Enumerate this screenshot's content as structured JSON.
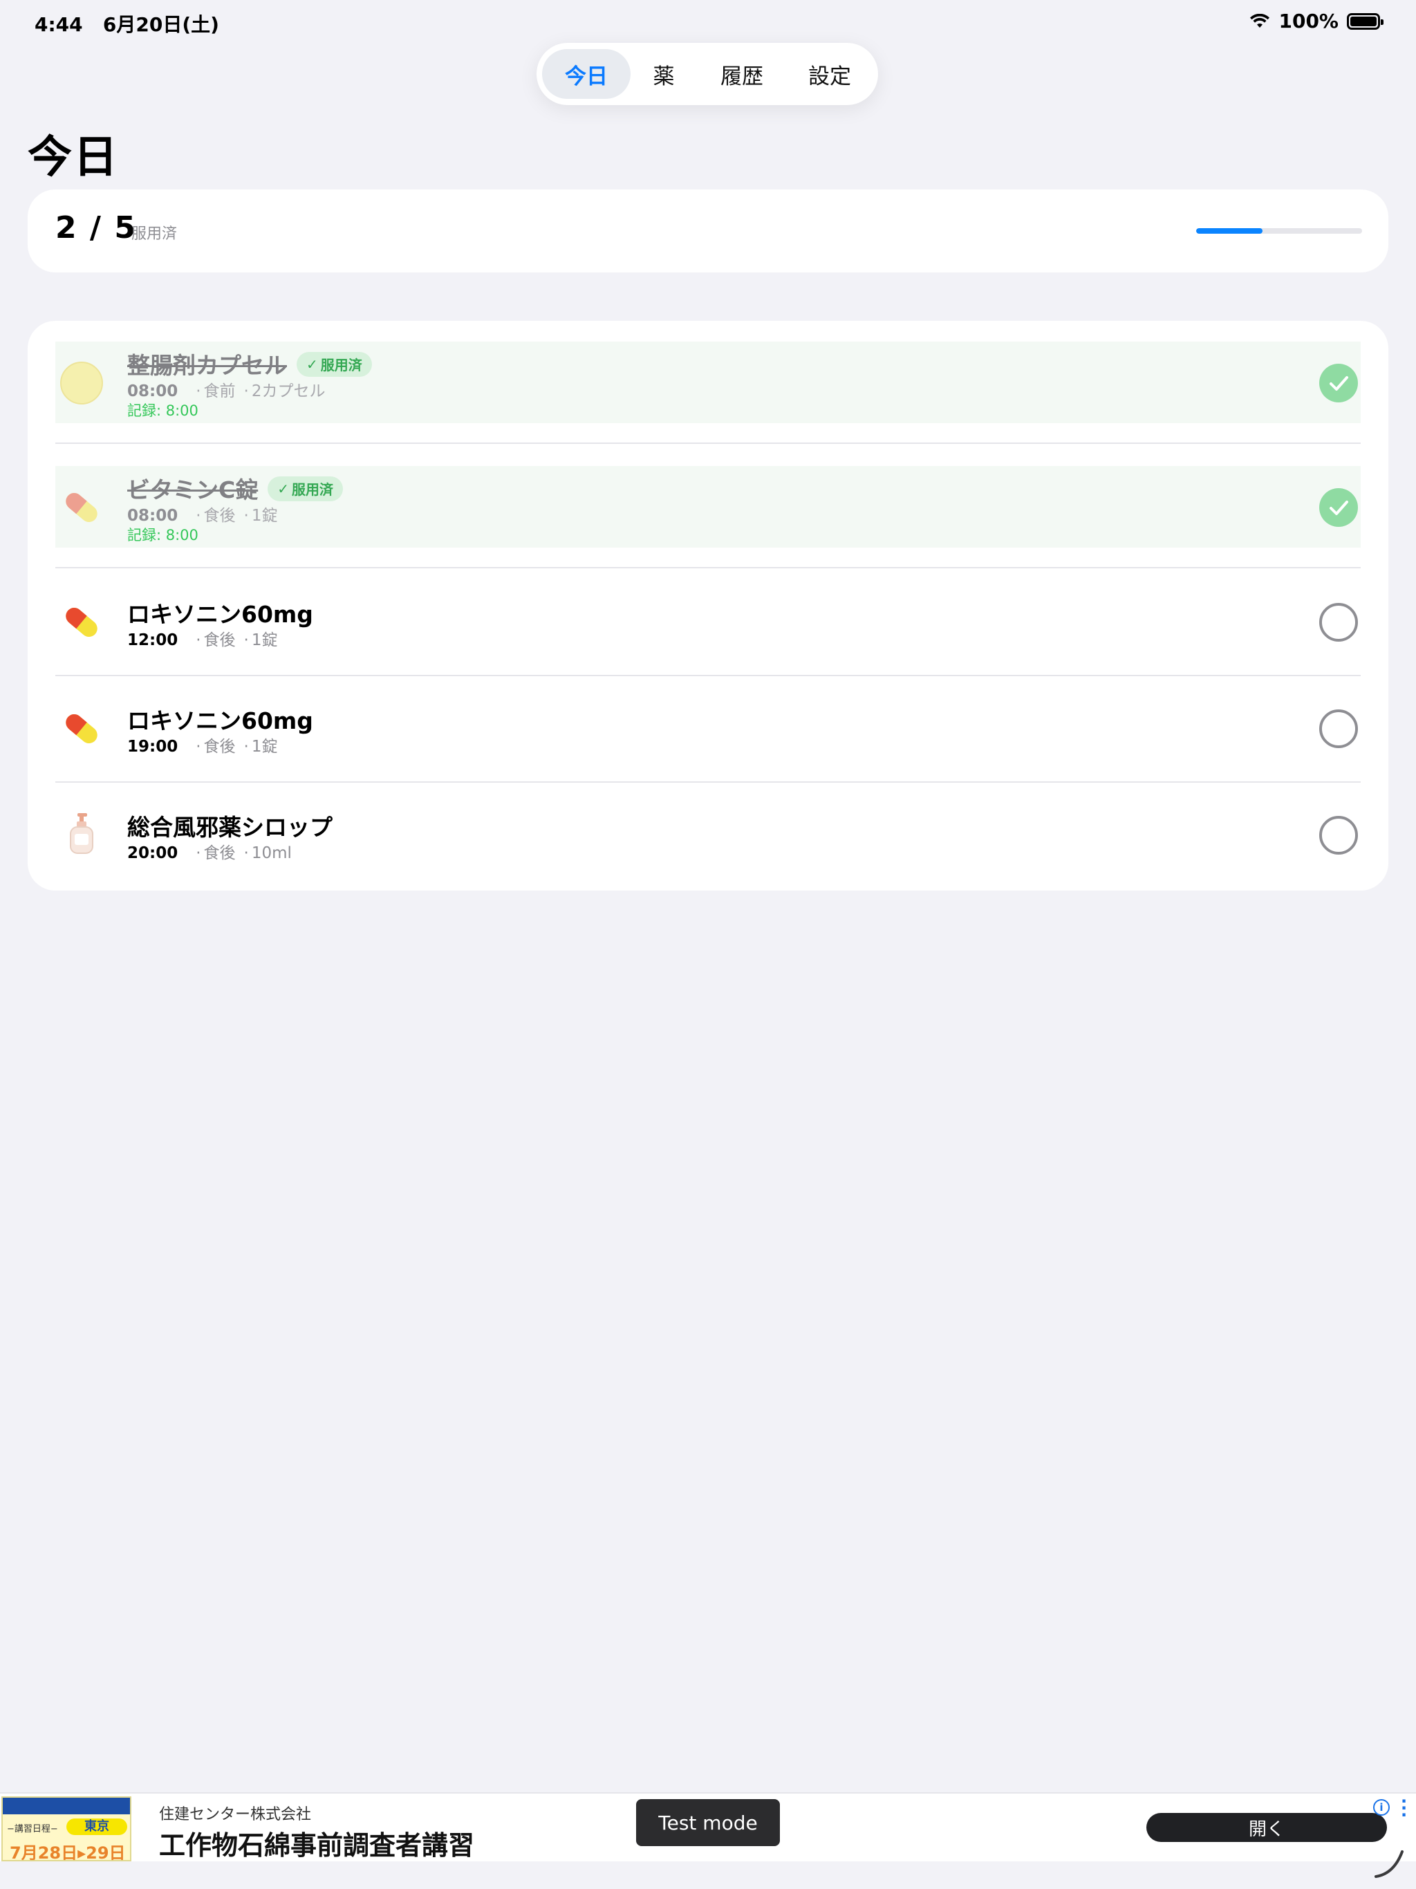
{
  "status": {
    "time": "4:44",
    "date": "6月20日(土)",
    "battery": "100%"
  },
  "tabs": [
    {
      "label": "今日",
      "active": true
    },
    {
      "label": "薬",
      "active": false
    },
    {
      "label": "履歴",
      "active": false
    },
    {
      "label": "設定",
      "active": false
    }
  ],
  "page": {
    "title": "今日"
  },
  "summary": {
    "count": "2 / 5",
    "label": "服用済",
    "progress": 0.4
  },
  "medications": [
    {
      "icon": "yellow-capsule-icon",
      "name": "整腸剤カプセル",
      "taken": true,
      "badge": "服用済",
      "time": "08:00",
      "timing": "食前",
      "dose": "2カプセル",
      "record": "記録: 8:00"
    },
    {
      "icon": "pill-icon",
      "name": "ビタミンC錠",
      "taken": true,
      "badge": "服用済",
      "time": "08:00",
      "timing": "食後",
      "dose": "1錠",
      "record": "記録: 8:00"
    },
    {
      "icon": "pill-icon",
      "name": "ロキソニン60mg",
      "taken": false,
      "time": "12:00",
      "timing": "食後",
      "dose": "1錠"
    },
    {
      "icon": "pill-icon",
      "name": "ロキソニン60mg",
      "taken": false,
      "time": "19:00",
      "timing": "食後",
      "dose": "1錠"
    },
    {
      "icon": "syrup-bottle-icon",
      "name": "総合風邪薬シロップ",
      "taken": false,
      "time": "20:00",
      "timing": "食後",
      "dose": "10ml"
    }
  ],
  "ad": {
    "thumb_sub": "−講習日程−",
    "thumb_city": "東京",
    "thumb_date": "7月28日▸29日",
    "advertiser": "住建センター株式会社",
    "headline": "工作物石綿事前調査者講習",
    "test_mode": "Test mode",
    "cta": "開く",
    "info": "i"
  },
  "colors": {
    "accent": "#0a84ff",
    "taken_green": "#34c759",
    "background": "#f2f2f7"
  }
}
